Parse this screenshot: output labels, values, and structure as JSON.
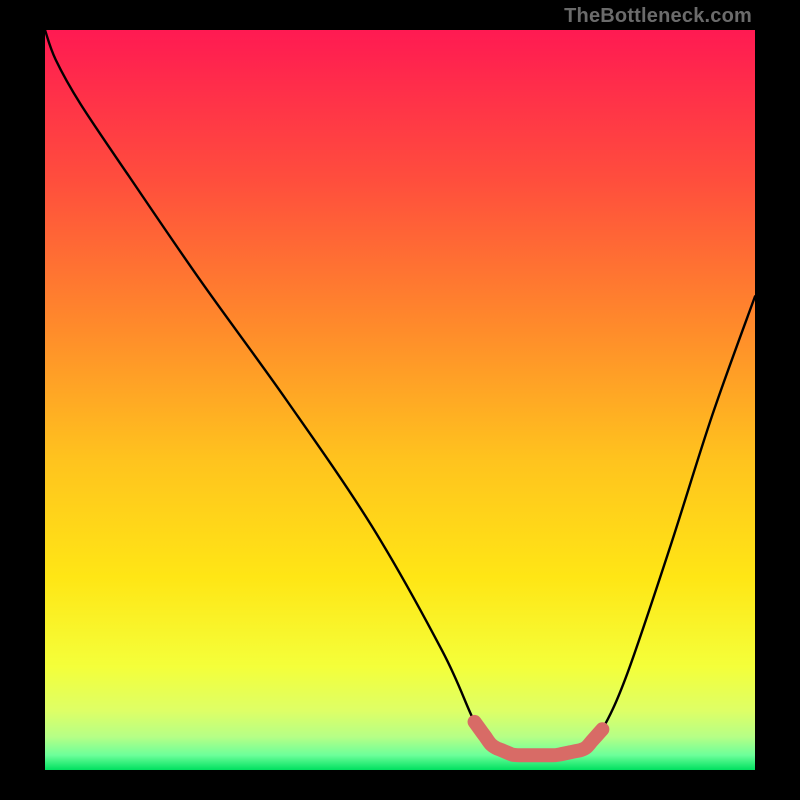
{
  "attribution": "TheBottleneck.com",
  "chart_data": {
    "type": "line",
    "title": "",
    "xlabel": "",
    "ylabel": "",
    "xlim": [
      0,
      100
    ],
    "ylim": [
      0,
      100
    ],
    "grid": false,
    "legend": false,
    "annotations": [],
    "gradient_stops": [
      {
        "offset": 0.0,
        "color": "#ff1a52"
      },
      {
        "offset": 0.2,
        "color": "#ff4d3d"
      },
      {
        "offset": 0.4,
        "color": "#ff8a2b"
      },
      {
        "offset": 0.58,
        "color": "#ffc31e"
      },
      {
        "offset": 0.74,
        "color": "#ffe615"
      },
      {
        "offset": 0.86,
        "color": "#f4ff3a"
      },
      {
        "offset": 0.92,
        "color": "#deff66"
      },
      {
        "offset": 0.955,
        "color": "#b6ff86"
      },
      {
        "offset": 0.98,
        "color": "#6cff9a"
      },
      {
        "offset": 1.0,
        "color": "#00e060"
      }
    ],
    "curve": {
      "description": "Bottleneck curve: high on left, descends to a flat minimum, rises again on right",
      "x": [
        0.0,
        1.5,
        5,
        12,
        22,
        34,
        46,
        56,
        60.5,
        63,
        66,
        72,
        76,
        78.5,
        82,
        88,
        94,
        100
      ],
      "y_pct": [
        100,
        96,
        90,
        80,
        66,
        50,
        33,
        16,
        6.5,
        3.2,
        2,
        2,
        2.8,
        5.5,
        13,
        30,
        48,
        64
      ]
    },
    "highlight_band": {
      "description": "Salmon rounded segment along the flat minimum",
      "x_start": 60.5,
      "x_end": 78.5,
      "color": "#d86b66",
      "thickness_px": 14
    }
  }
}
